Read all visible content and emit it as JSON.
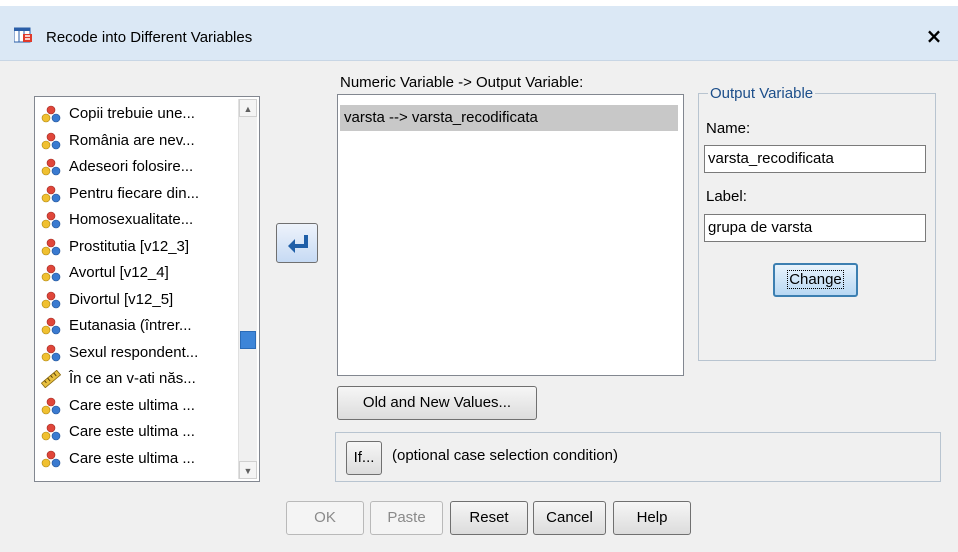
{
  "window": {
    "title": "Recode into Different Variables",
    "close_glyph": "×"
  },
  "source_list": {
    "items": [
      {
        "label": "Copii trebuie une...",
        "icon": "nominal-variable-icon"
      },
      {
        "label": "România are nev...",
        "icon": "nominal-variable-icon"
      },
      {
        "label": "Adeseori folosire...",
        "icon": "nominal-variable-icon"
      },
      {
        "label": "Pentru fiecare din...",
        "icon": "nominal-variable-icon"
      },
      {
        "label": "Homosexualitate...",
        "icon": "nominal-variable-icon"
      },
      {
        "label": "Prostitutia [v12_3]",
        "icon": "nominal-variable-icon"
      },
      {
        "label": "Avortul [v12_4]",
        "icon": "nominal-variable-icon"
      },
      {
        "label": "Divortul [v12_5]",
        "icon": "nominal-variable-icon"
      },
      {
        "label": "Eutanasia (întrer...",
        "icon": "nominal-variable-icon"
      },
      {
        "label": "Sexul respondent...",
        "icon": "nominal-variable-icon"
      },
      {
        "label": "În ce an v-ati năs...",
        "icon": "scale-variable-icon"
      },
      {
        "label": "Care este ultima ...",
        "icon": "nominal-variable-icon"
      },
      {
        "label": "Care este ultima ...",
        "icon": "nominal-variable-icon"
      },
      {
        "label": "Care este ultima ...",
        "icon": "nominal-variable-icon"
      }
    ]
  },
  "numeric_variable": {
    "label": "Numeric Variable -> Output Variable:",
    "rows": [
      "varsta --> varsta_recodificata"
    ]
  },
  "output_variable": {
    "group_title": "Output Variable",
    "name_label": "Name:",
    "name_value": "varsta_recodificata",
    "label_label": "Label:",
    "label_value": "grupa de varsta",
    "change_button": "Change"
  },
  "old_new_button": "Old and New Values...",
  "if_section": {
    "button": "If...",
    "text": "(optional case selection condition)"
  },
  "buttons": {
    "ok": "OK",
    "paste": "Paste",
    "reset": "Reset",
    "cancel": "Cancel",
    "help": "Help"
  },
  "colors": {
    "titlebar": "#dbe8f5",
    "selection": "#c8c8c8",
    "group_title": "#1c4e8a",
    "scroll_thumb": "#3d85d8"
  }
}
